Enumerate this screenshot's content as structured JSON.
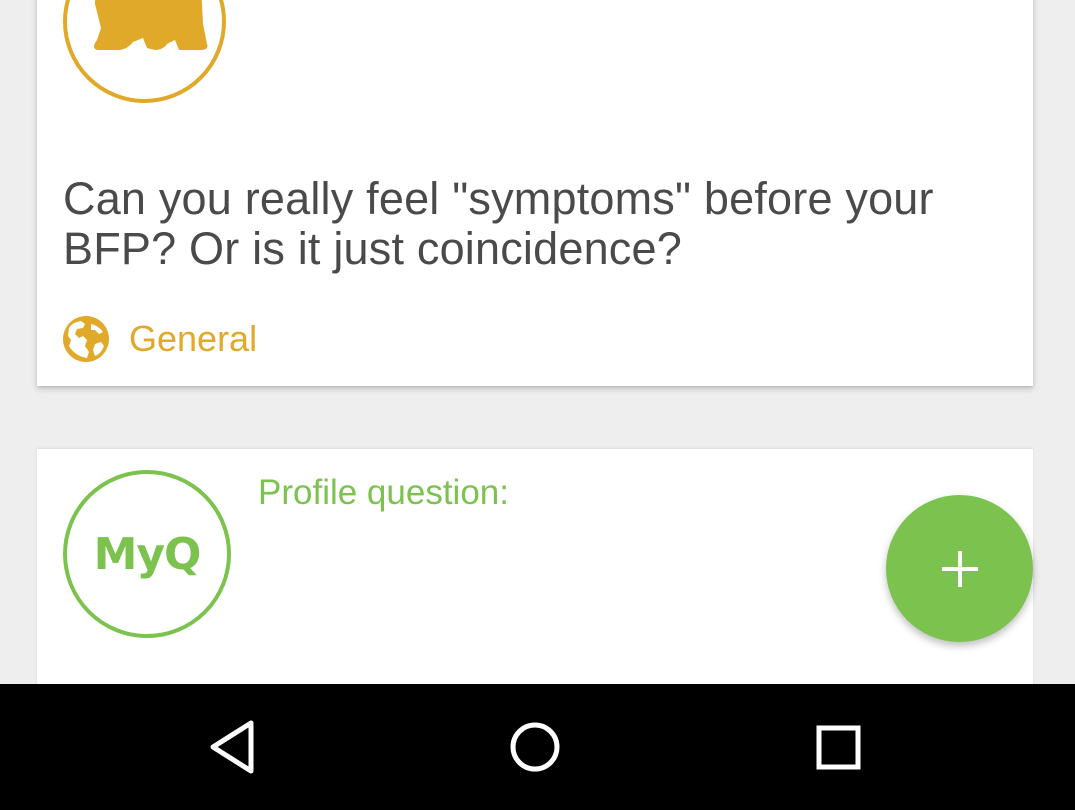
{
  "colors": {
    "accent_gold": "#e0a92a",
    "accent_green": "#7cc24e",
    "text_dark": "#4a4a4a",
    "background": "#eeeeee",
    "card": "#ffffff",
    "nav_bar": "#000000"
  },
  "question_card": {
    "avatar_icon": "bear-icon",
    "question": "Can you really feel \"symptoms\" before your BFP? Or is it just coincidence?",
    "category": {
      "icon": "globe-icon",
      "label": "General"
    }
  },
  "profile_card": {
    "avatar_text": "MyQ",
    "label": "Profile question:"
  },
  "fab": {
    "icon": "plus-icon"
  },
  "nav_bar": {
    "buttons": [
      {
        "name": "back",
        "icon": "triangle-back-icon"
      },
      {
        "name": "home",
        "icon": "circle-home-icon"
      },
      {
        "name": "recents",
        "icon": "square-recents-icon"
      }
    ]
  }
}
